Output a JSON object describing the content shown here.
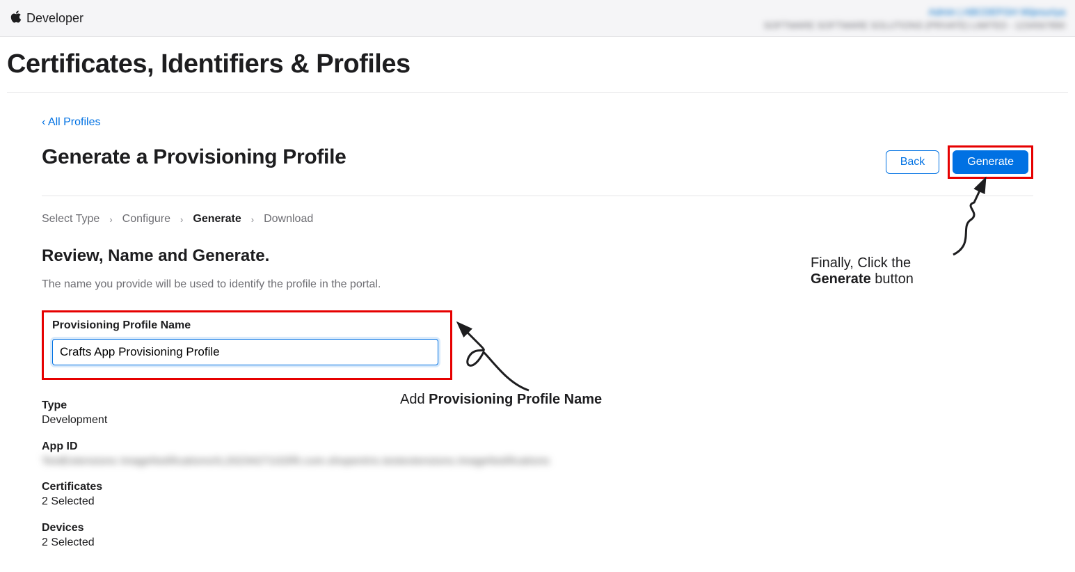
{
  "topbar": {
    "brand": "Developer",
    "account_line1": "Admin | ABCDEFGH Wijesuriya",
    "account_line2": "SOFTWARE SOFTWARE SOLUTIONS (PRIVATE) LIMITED - 1234567890"
  },
  "page": {
    "title": "Certificates, Identifiers & Profiles"
  },
  "nav": {
    "back_link": "‹ All Profiles"
  },
  "section": {
    "title": "Generate a Provisioning Profile",
    "back_button": "Back",
    "generate_button": "Generate"
  },
  "steps": {
    "items": [
      "Select Type",
      "Configure",
      "Generate",
      "Download"
    ],
    "active_index": 2
  },
  "review": {
    "heading": "Review, Name and Generate.",
    "description": "The name you provide will be used to identify the profile in the portal."
  },
  "form": {
    "name_label": "Provisioning Profile Name",
    "name_value": "Crafts App Provisioning Profile"
  },
  "info": {
    "type_label": "Type",
    "type_value": "Development",
    "appid_label": "App ID",
    "appid_value": "TestExtensions ImageNotificationsXL20234271GDf0.com.shopentrix.testextensions.ImageNotifications",
    "certificates_label": "Certificates",
    "certificates_value": "2 Selected",
    "devices_label": "Devices",
    "devices_value": "2 Selected"
  },
  "annotations": {
    "generate_text_1": "Finally, Click the",
    "generate_text_2a": "Generate",
    "generate_text_2b": " button",
    "name_text_1": "Add ",
    "name_text_2": "Provisioning Profile Name"
  }
}
